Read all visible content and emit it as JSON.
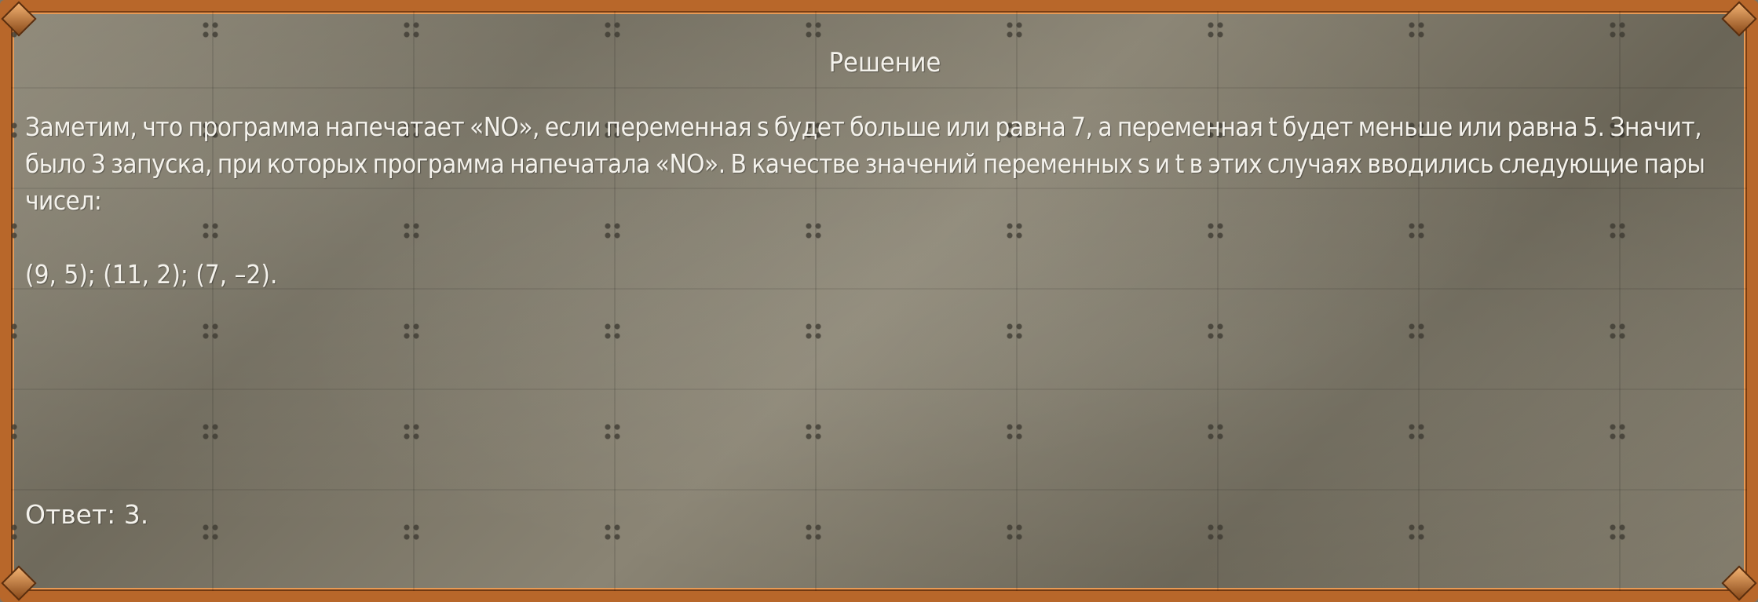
{
  "panel": {
    "title": "Решение",
    "paragraph": "Заметим, что программа напечатает «NO», если переменная s будет больше или равна 7, а переменная t будет меньше или равна 5. Значит, было 3 запуска, при которых программа напечатала «NO». В качестве значений переменных s и t в этих случаях вводились следующие пары чисел:",
    "pairs": "(9, 5); (11, 2); (7, –2).",
    "answer": "Ответ: 3."
  },
  "colors": {
    "frame": "#b8672a",
    "text": "#f4f2ec",
    "background": "#7a7466"
  }
}
